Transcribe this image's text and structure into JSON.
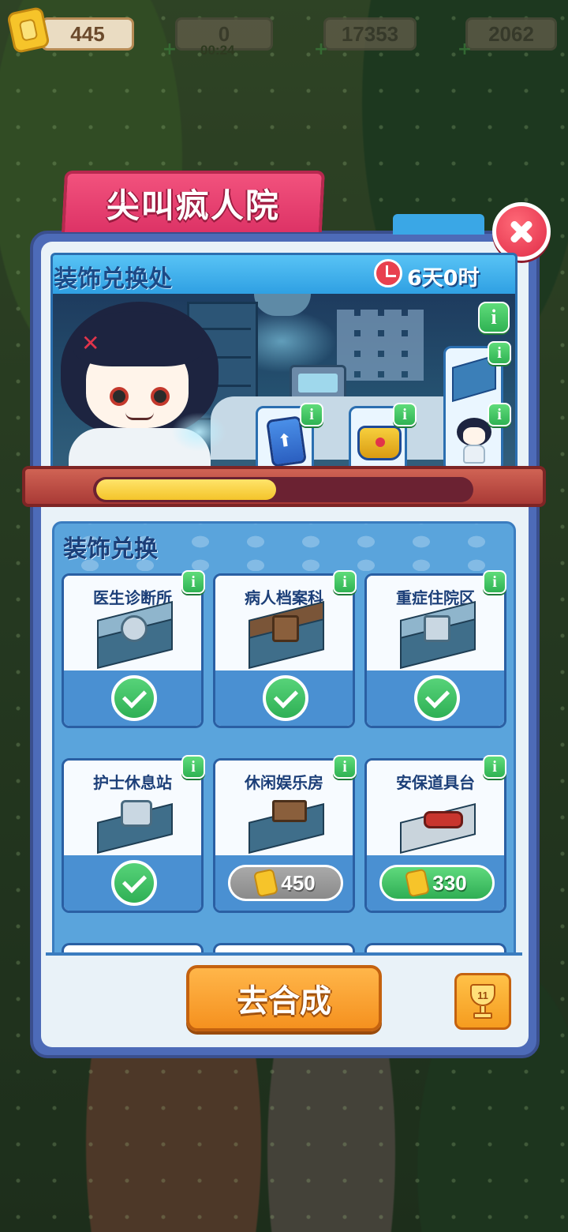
{
  "currencies": {
    "tickets": "445",
    "energy": "0",
    "energy_timer": "00:24",
    "coins": "17353",
    "gems": "2062"
  },
  "panel": {
    "title": "尖叫疯人院",
    "header_title": "装饰兑换处",
    "countdown": "6天0时",
    "progress": 0.48,
    "rewards": [
      "upgrade-card",
      "treasure-chest",
      "room-decoration",
      "character-skin"
    ]
  },
  "exchange": {
    "section_title": "装饰兑换",
    "items": [
      {
        "name": "医生诊断所",
        "status": "owned"
      },
      {
        "name": "病人档案科",
        "status": "owned"
      },
      {
        "name": "重症住院区",
        "status": "owned"
      },
      {
        "name": "护士休息站",
        "status": "owned"
      },
      {
        "name": "休闲娱乐房",
        "status": "locked",
        "price": "450"
      },
      {
        "name": "安保道具台",
        "status": "available",
        "price": "330"
      }
    ]
  },
  "footer": {
    "merge_button": "去合成",
    "trophy_count": "11"
  },
  "icons": {
    "info": "i",
    "colors": {
      "accent_pink": "#e8406e",
      "header_blue": "#2fa0e3",
      "merge_orange": "#f5911f",
      "check_green": "#2fb055"
    }
  }
}
